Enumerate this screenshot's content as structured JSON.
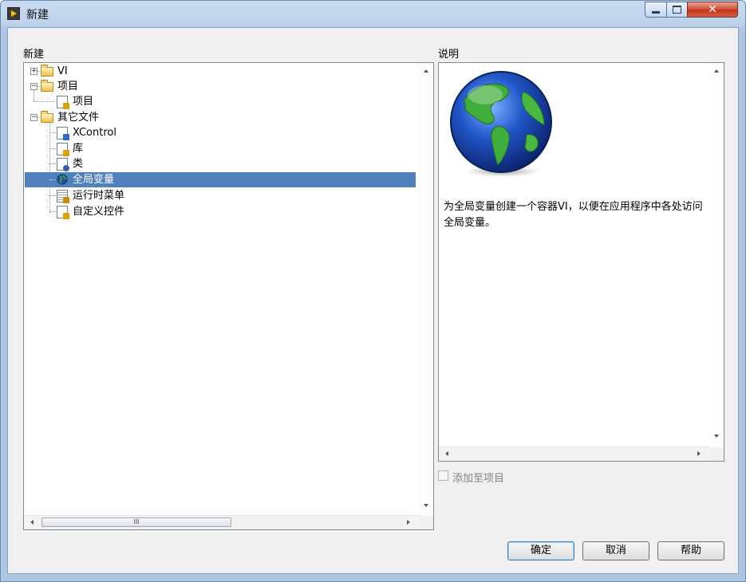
{
  "window": {
    "title": "新建",
    "minimize_icon": "minimize-icon",
    "maximize_icon": "maximize-icon",
    "close_icon": "close-icon",
    "close_glyph": "✕"
  },
  "left_panel": {
    "label": "新建",
    "tree": [
      {
        "label": "VI",
        "icon": "folder-icon",
        "expander": "+"
      },
      {
        "label": "项目",
        "icon": "folder-icon",
        "expander": "−"
      },
      {
        "label": "项目",
        "icon": "project-icon"
      },
      {
        "label": "其它文件",
        "icon": "folder-icon",
        "expander": "−"
      },
      {
        "label": "XControl",
        "icon": "xcontrol-icon"
      },
      {
        "label": "库",
        "icon": "library-icon"
      },
      {
        "label": "类",
        "icon": "class-icon"
      },
      {
        "label": "全局变量",
        "icon": "global-variable-icon",
        "selected": true
      },
      {
        "label": "运行时菜单",
        "icon": "runtime-menu-icon"
      },
      {
        "label": "自定义控件",
        "icon": "custom-control-icon"
      }
    ],
    "hscroll_thumb_glyph": "III"
  },
  "right_panel": {
    "label": "说明",
    "image": "globe-icon",
    "description": "为全局变量创建一个容器VI，以便在应用程序中各处访问全局变量。"
  },
  "add_to_project": {
    "label": "添加至项目",
    "checked": false
  },
  "buttons": {
    "ok": "确定",
    "cancel": "取消",
    "help": "帮助"
  },
  "colors": {
    "selection": "#4f81bd",
    "title_bar": "#bcd2eb",
    "close_button": "#c2321b"
  }
}
